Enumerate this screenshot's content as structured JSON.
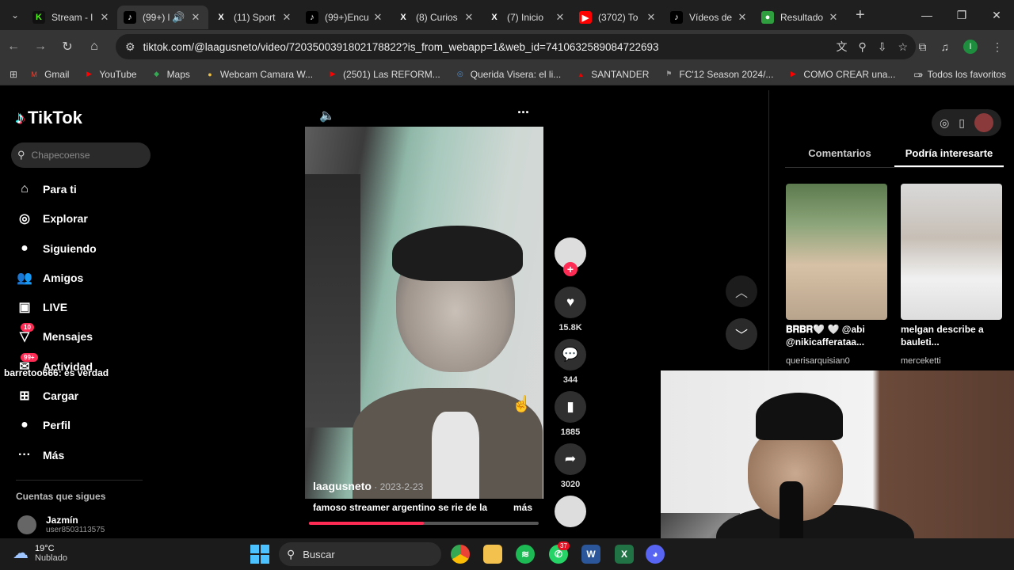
{
  "browser": {
    "tabs": [
      {
        "title": "Stream - l",
        "fav": "K",
        "fav_color": "#53fc18",
        "fav_bg": "#111"
      },
      {
        "title": "(99+) l",
        "fav": "♪",
        "fav_color": "#fff",
        "fav_bg": "#000",
        "active": true
      },
      {
        "title": "(11) Sport",
        "fav": "X",
        "fav_color": "#fff",
        "fav_bg": "#1f1f1f"
      },
      {
        "title": "(99+)Encu",
        "fav": "♪",
        "fav_color": "#fff",
        "fav_bg": "#000"
      },
      {
        "title": "(8) Curios",
        "fav": "X",
        "fav_color": "#fff",
        "fav_bg": "#1f1f1f"
      },
      {
        "title": "(7) Inicio",
        "fav": "X",
        "fav_color": "#fff",
        "fav_bg": "#1f1f1f"
      },
      {
        "title": "(3702) To",
        "fav": "▶",
        "fav_color": "#fff",
        "fav_bg": "#ff0000"
      },
      {
        "title": "Vídeos de",
        "fav": "♪",
        "fav_color": "#fff",
        "fav_bg": "#000"
      },
      {
        "title": "Resultado",
        "fav": "●",
        "fav_color": "#fff",
        "fav_bg": "#2e9e3e"
      }
    ],
    "url": "tiktok.com/@laagusneto/video/7203500391802178822?is_from_webapp=1&web_id=7410632589084722693",
    "profile_initial": "I",
    "bookmarks": [
      {
        "label": "Gmail",
        "icon": "M",
        "color": "#ea4335"
      },
      {
        "label": "YouTube",
        "icon": "▶",
        "color": "#ff0000"
      },
      {
        "label": "Maps",
        "icon": "◆",
        "color": "#34a853"
      },
      {
        "label": "Webcam Camara W...",
        "icon": "●",
        "color": "#f0c040"
      },
      {
        "label": "(2501) Las REFORM...",
        "icon": "▶",
        "color": "#ff0000"
      },
      {
        "label": "Querida Visera: el li...",
        "icon": "◎",
        "color": "#4a90d9"
      },
      {
        "label": "SANTANDER",
        "icon": "▲",
        "color": "#ec0000"
      },
      {
        "label": "FC'12 Season 2024/...",
        "icon": "⚑",
        "color": "#999"
      },
      {
        "label": "COMO CREAR una...",
        "icon": "▶",
        "color": "#ff0000"
      }
    ],
    "all_bookmarks": "Todos los favoritos"
  },
  "sidebar": {
    "logo": "TikTok",
    "search_placeholder": "Chapecoense",
    "nav": [
      {
        "label": "Para ti",
        "icon": "⌂"
      },
      {
        "label": "Explorar",
        "icon": "◎"
      },
      {
        "label": "Siguiendo",
        "icon": "●"
      },
      {
        "label": "Amigos",
        "icon": "👥"
      },
      {
        "label": "LIVE",
        "icon": "▣"
      },
      {
        "label": "Mensajes",
        "icon": "▽",
        "badge": "10"
      },
      {
        "label": "Actividad",
        "icon": "✉",
        "badge": "99+"
      },
      {
        "label": "Cargar",
        "icon": "⊞"
      },
      {
        "label": "Perfil",
        "icon": "●"
      },
      {
        "label": "Más",
        "icon": "···"
      }
    ],
    "following_title": "Cuentas que sigues",
    "following": [
      {
        "name": "Jazmín",
        "user": "user8503113575"
      }
    ]
  },
  "chat_overlay": {
    "user": "barretoo666",
    "message": ": es verdad"
  },
  "video": {
    "author": "laagusneto",
    "date": " · 2023-2-23",
    "description": "famoso streamer argentino se rie de la",
    "more": "más",
    "progress": 0.5,
    "likes": "15.8K",
    "comments": "344",
    "saves": "1885",
    "shares": "3020"
  },
  "right_panel": {
    "tabs": [
      "Comentarios",
      "Podría interesarte"
    ],
    "active_tab": 1,
    "suggestions": [
      {
        "caption": "𝐁𝐑𝐁𝐑🤍 🤍 @abi @nikicafferataa...",
        "user": "querisarquisian0"
      },
      {
        "caption": "melgan describe a bauleti...",
        "user": "merceketti"
      }
    ]
  },
  "taskbar": {
    "temp": "19°C",
    "weather": "Nublado",
    "search": "Buscar",
    "whatsapp_badge": "37"
  }
}
